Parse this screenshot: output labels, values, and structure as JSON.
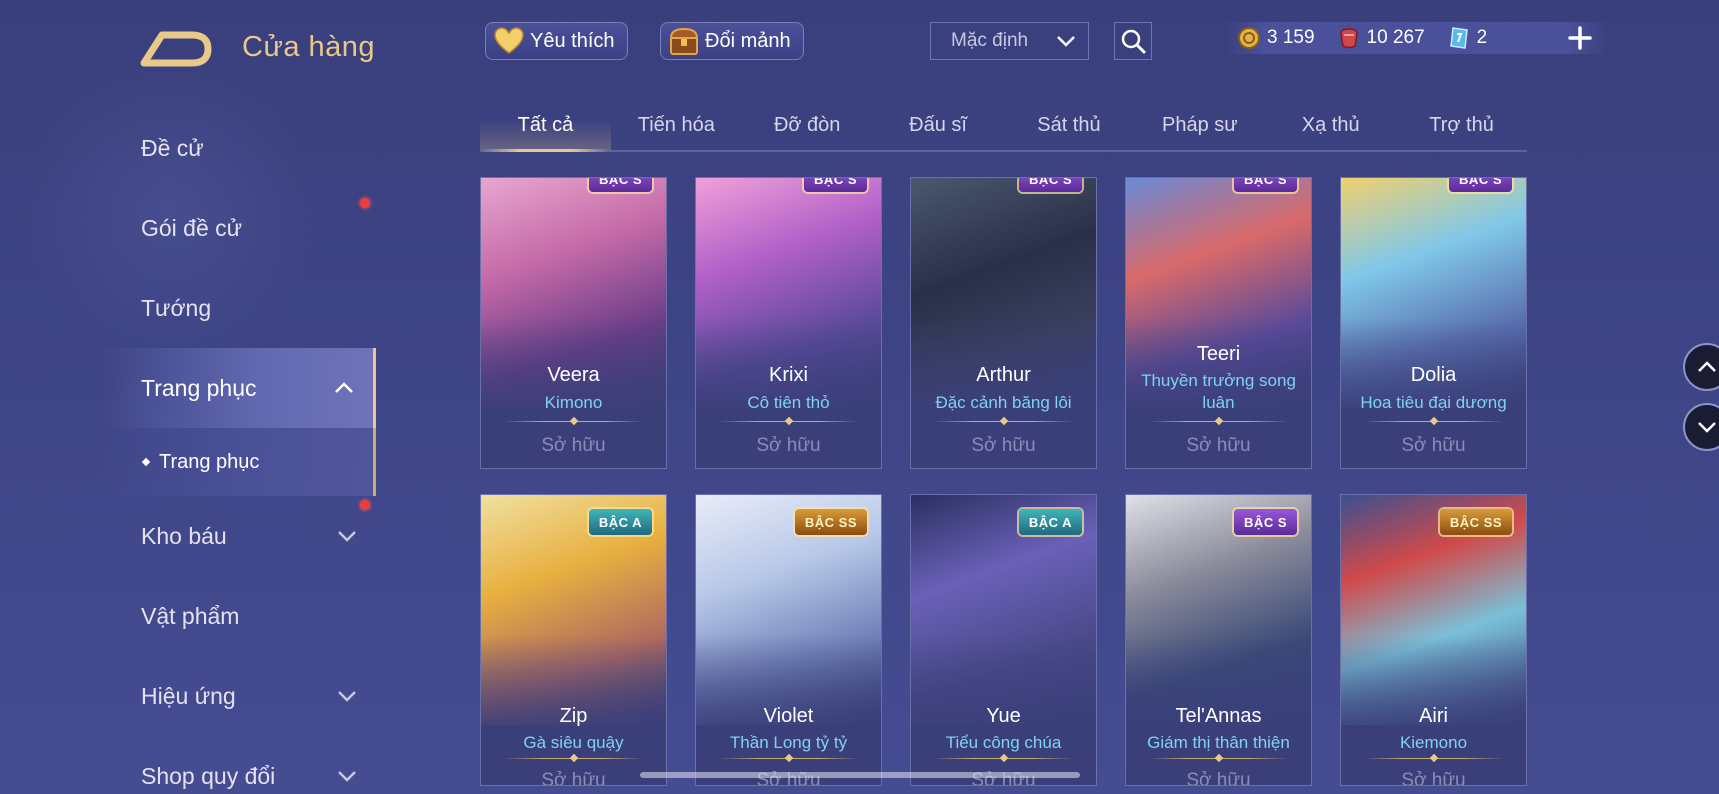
{
  "header": {
    "title": "Cửa hàng",
    "favorites_label": "Yêu thích",
    "exchange_label": "Đổi mảnh",
    "sort_value": "Mặc định"
  },
  "currency": {
    "gold": "3 159",
    "vouchers": "10 267",
    "tickets": "2"
  },
  "sidebar": {
    "items": [
      {
        "label": "Đề cử"
      },
      {
        "label": "Gói đề cử"
      },
      {
        "label": "Tướng"
      },
      {
        "label": "Trang phục"
      },
      {
        "label": "Trang phục"
      },
      {
        "label": "Kho báu"
      },
      {
        "label": "Vật phẩm"
      },
      {
        "label": "Hiệu ứng"
      },
      {
        "label": "Shop quy đổi"
      }
    ]
  },
  "tabs": [
    "Tất cả",
    "Tiến hóa",
    "Đỡ đòn",
    "Đấu sĩ",
    "Sát thủ",
    "Pháp sư",
    "Xạ thủ",
    "Trợ thủ"
  ],
  "cards": [
    {
      "hero": "Veera",
      "skin": "Kimono",
      "tier": "BẬC S",
      "owned": "Sở hữu"
    },
    {
      "hero": "Krixi",
      "skin": "Cô tiên thỏ",
      "tier": "BẬC S",
      "owned": "Sở hữu"
    },
    {
      "hero": "Arthur",
      "skin": "Đặc cảnh băng lôi",
      "tier": "BẬC S",
      "owned": "Sở hữu"
    },
    {
      "hero": "Teeri",
      "skin": "Thuyền trưởng song luân",
      "tier": "BẬC S",
      "owned": "Sở hữu"
    },
    {
      "hero": "Dolia",
      "skin": "Hoa tiêu đại dương",
      "tier": "BẬC S",
      "owned": "Sở hữu"
    },
    {
      "hero": "Zip",
      "skin": "Gà siêu quậy",
      "tier": "BẬC A",
      "owned": "Sở hữu"
    },
    {
      "hero": "Violet",
      "skin": "Thần Long tỷ tỷ",
      "tier": "BẬC SS",
      "owned": "Sở hữu"
    },
    {
      "hero": "Yue",
      "skin": "Tiểu công chúa",
      "tier": "BẬC A",
      "owned": "Sở hữu"
    },
    {
      "hero": "Tel'Annas",
      "skin": "Giám thị thân thiện",
      "tier": "BẬC S",
      "owned": "Sở hữu"
    },
    {
      "hero": "Airi",
      "skin": "Kiemono",
      "tier": "BẬC SS",
      "owned": "Sở hữu"
    }
  ],
  "colors": {
    "accent_gold": "#e8c98a",
    "skin_name": "#7fd2f0",
    "notification_dot": "#ef3b3b"
  }
}
